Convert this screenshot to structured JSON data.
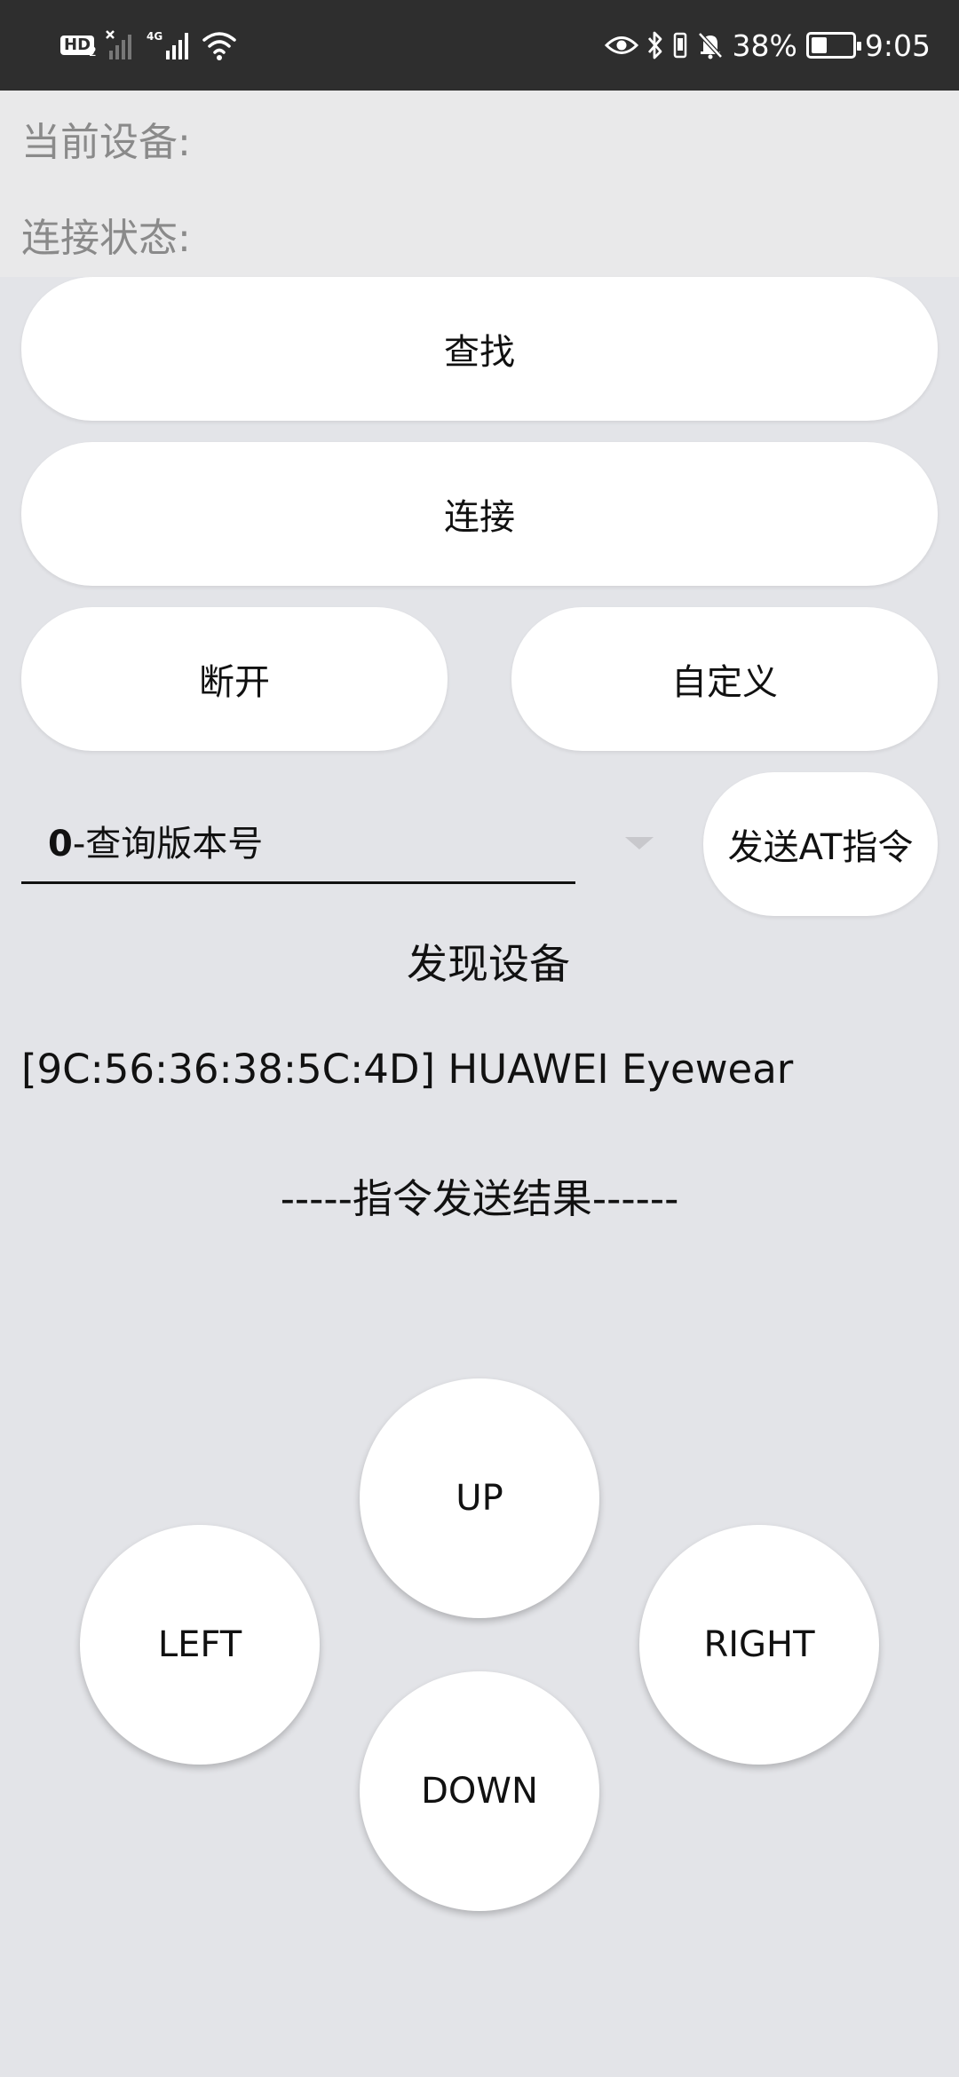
{
  "status_bar": {
    "hd_label": "HD",
    "hd_sub": "2",
    "network_4g": "4G",
    "battery_percent": "38%",
    "battery_level": 0.38,
    "time": "9:05",
    "icons": [
      "hd-icon",
      "signal-off-icon",
      "signal-4g-icon",
      "wifi-icon",
      "eye-icon",
      "bluetooth-icon",
      "vibrate-icon",
      "mute-bell-icon",
      "battery-icon"
    ]
  },
  "info": {
    "current_device_label": "当前设备:",
    "connection_status_label": "连接状态:"
  },
  "buttons": {
    "search": "查找",
    "connect": "连接",
    "disconnect": "断开",
    "custom": "自定义",
    "send_at": "发送AT指令"
  },
  "command_select": {
    "selected_prefix": "0",
    "selected_rest": "-查询版本号"
  },
  "devices": {
    "header": "发现设备",
    "items": [
      "[9C:56:36:38:5C:4D] HUAWEI Eyewear"
    ]
  },
  "result": {
    "header": "-----指令发送结果------"
  },
  "dpad": {
    "up": "UP",
    "left": "LEFT",
    "right": "RIGHT",
    "down": "DOWN"
  }
}
